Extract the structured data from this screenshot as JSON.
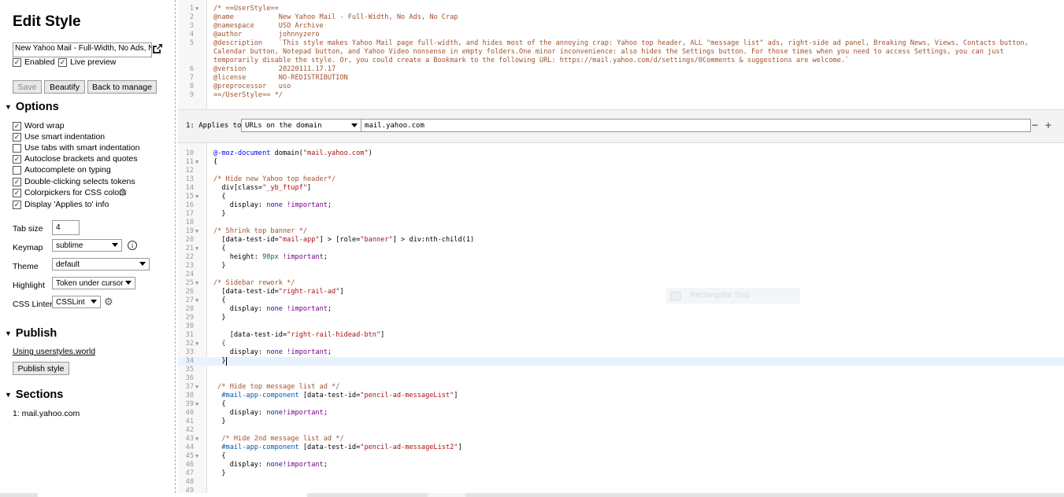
{
  "sidebar": {
    "title": "Edit Style",
    "style_name": "New Yahoo Mail - Full-Width, No Ads, N",
    "enabled_label": "Enabled",
    "live_preview_label": "Live preview",
    "enabled_checked": true,
    "live_preview_checked": true,
    "buttons": {
      "save": "Save",
      "beautify": "Beautify",
      "back": "Back to manage"
    },
    "options": {
      "heading": "Options",
      "items": [
        {
          "label": "Word wrap",
          "checked": true
        },
        {
          "label": "Use smart indentation",
          "checked": true
        },
        {
          "label": "Use tabs with smart indentation",
          "checked": false
        },
        {
          "label": "Autoclose brackets and quotes",
          "checked": true
        },
        {
          "label": "Autocomplete on typing",
          "checked": false
        },
        {
          "label": "Double-clicking selects tokens",
          "checked": true
        },
        {
          "label": "Colorpickers for CSS colors",
          "checked": true
        },
        {
          "label": "Display 'Applies to' info",
          "checked": true
        }
      ],
      "tab_size_label": "Tab size",
      "tab_size_value": "4",
      "keymap_label": "Keymap",
      "keymap_value": "sublime",
      "theme_label": "Theme",
      "theme_value": "default",
      "highlight_label": "Highlight",
      "highlight_value": "Token under cursor",
      "linter_label": "CSS Linter",
      "linter_value": "CSSLint"
    },
    "publish": {
      "heading": "Publish",
      "link": "Using userstyles.world",
      "button": "Publish style"
    },
    "sections": {
      "heading": "Sections",
      "items": [
        "1: mail.yahoo.com"
      ]
    }
  },
  "editor": {
    "meta_lines": [
      {
        "n": "1",
        "fold": true,
        "t": "/* ==UserStyle=="
      },
      {
        "n": "2",
        "t": "@name           New Yahoo Mail - Full-Width, No Ads, No Crap"
      },
      {
        "n": "3",
        "t": "@namespace      USO Archive"
      },
      {
        "n": "4",
        "t": "@author         johnnyzero"
      },
      {
        "n": "5",
        "t": "@description    `This style makes Yahoo Mail page full-width, and hides most of the annoying crap: Yahoo top header, ALL \"message list\" ads, right-side ad panel, Breaking News, Views, Contacts button,"
      },
      {
        "n": "",
        "t": "Calendar button, Notepad button, and Yahoo Video nonsense in empty folders.One minor inconvenience: also hides the Settings button. For those times when you need to access Settings, you can just"
      },
      {
        "n": "",
        "t": "temporarily disable the style. Or, you could create a Bookmark to the following URL: https://mail.yahoo.com/d/settings/0Comments & suggestions are welcome.`"
      },
      {
        "n": "6",
        "t": "@version        20220111.17.17"
      },
      {
        "n": "7",
        "t": "@license        NO-REDISTRIBUTION"
      },
      {
        "n": "8",
        "t": "@preprocessor   uso"
      },
      {
        "n": "9",
        "t": "==/UserStyle== */"
      }
    ],
    "applies": {
      "label": "1: Applies to",
      "type": "URLs on the domain",
      "value": "mail.yahoo.com",
      "minus": "−",
      "plus": "+"
    },
    "code_lines": [
      {
        "n": "10",
        "t": "@-moz-document domain(\"mail.yahoo.com\")",
        "k": "doc"
      },
      {
        "n": "11",
        "fold": true,
        "t": "{"
      },
      {
        "n": "12",
        "t": ""
      },
      {
        "n": "13",
        "t": "/* Hide new Yahoo top header*/",
        "k": "com"
      },
      {
        "n": "14",
        "t": "  div[class=\"_yb_ftupf\"]",
        "k": "sel"
      },
      {
        "n": "15",
        "fold": true,
        "t": "  {"
      },
      {
        "n": "16",
        "t": "    display: none !important;",
        "k": "prop"
      },
      {
        "n": "17",
        "t": "  }"
      },
      {
        "n": "18",
        "t": ""
      },
      {
        "n": "19",
        "fold": true,
        "t": "/* Shrink top banner */",
        "k": "com"
      },
      {
        "n": "20",
        "t": "  [data-test-id=\"mail-app\"] > [role=\"banner\"] > div:nth-child(1)",
        "k": "sel"
      },
      {
        "n": "21",
        "fold": true,
        "t": "  {"
      },
      {
        "n": "22",
        "t": "    height: 98px !important;",
        "k": "prop"
      },
      {
        "n": "23",
        "t": "  }"
      },
      {
        "n": "24",
        "t": ""
      },
      {
        "n": "25",
        "fold": true,
        "t": "/* Sidebar rework */",
        "k": "com"
      },
      {
        "n": "26",
        "t": "  [data-test-id=\"right-rail-ad\"]",
        "k": "sel"
      },
      {
        "n": "27",
        "fold": true,
        "t": "  {"
      },
      {
        "n": "28",
        "t": "    display: none !important;",
        "k": "prop"
      },
      {
        "n": "29",
        "t": "  }"
      },
      {
        "n": "30",
        "t": ""
      },
      {
        "n": "31",
        "t": "    [data-test-id=\"right-rail-hidead-btn\"]",
        "k": "sel"
      },
      {
        "n": "32",
        "fold": true,
        "t": "  {",
        "k": "bracket"
      },
      {
        "n": "33",
        "t": "    display: none !important;",
        "k": "prop"
      },
      {
        "n": "34",
        "t": "  }",
        "active": true
      },
      {
        "n": "35",
        "t": ""
      },
      {
        "n": "36",
        "t": ""
      },
      {
        "n": "37",
        "fold": true,
        "t": " /* Hide top message list ad */",
        "k": "com"
      },
      {
        "n": "38",
        "t": "  #mail-app-component [data-test-id=\"pencil-ad-messageList\"]",
        "k": "sel"
      },
      {
        "n": "39",
        "fold": true,
        "t": "  {"
      },
      {
        "n": "40",
        "t": "    display: none!important;",
        "k": "prop"
      },
      {
        "n": "41",
        "t": "  }"
      },
      {
        "n": "42",
        "t": ""
      },
      {
        "n": "43",
        "fold": true,
        "t": "  /* Hide 2nd message list ad */",
        "k": "com"
      },
      {
        "n": "44",
        "t": "  #mail-app-component [data-test-id=\"pencil-ad-messageList2\"]",
        "k": "sel"
      },
      {
        "n": "45",
        "fold": true,
        "t": "  {"
      },
      {
        "n": "46",
        "t": "    display: none!important;",
        "k": "prop"
      },
      {
        "n": "47",
        "t": "  }"
      },
      {
        "n": "48",
        "t": ""
      },
      {
        "n": "49",
        "t": ""
      }
    ]
  },
  "tooltip": {
    "text": "Rectangular Snip"
  },
  "colors": {
    "comment": "#a0522d",
    "string": "#aa1111",
    "keyword": "#770088",
    "property": "#0000ff",
    "active_line": "#e8f2ff",
    "gutter": "#f7f7f7"
  }
}
